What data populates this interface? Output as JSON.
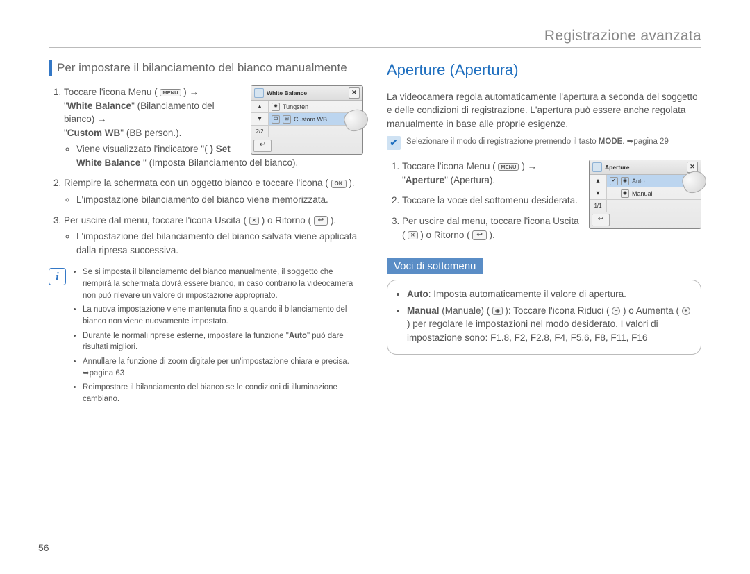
{
  "header": {
    "chapter": "Registrazione avanzata"
  },
  "page_number": "56",
  "left": {
    "title": "Per impostare il bilanciamento del bianco manualmente",
    "step1": {
      "pre": "Toccare l'icona Menu (",
      "menu": "MENU",
      "post": ") →",
      "wb_label": "White Balance",
      "wb_desc": "(Bilanciamento del bianco) →",
      "custom_label": "Custom WB",
      "custom_desc": "(BB person.).",
      "bullet1_pre": "Viene visualizzato l'indicatore \"( ",
      "bullet1_bold": "Set White Balance",
      "bullet1_post": "\" (Imposta Bilanciamento del bianco)."
    },
    "step2": {
      "text": "Riempire la schermata con un oggetto bianco e toccare l'icona ( ",
      "ok": "OK",
      "text_end": " ).",
      "bullet": "L'impostazione bilanciamento del bianco viene memorizzata."
    },
    "step3": {
      "text_a": "Per uscire dal menu, toccare l'icona Uscita ( ",
      "x": "✕",
      "text_b": " ) o Ritorno ( ",
      "ret": "↩",
      "text_c": " ).",
      "bullet": "L'impostazione del bilanciamento del bianco salvata viene applicata dalla ripresa successiva."
    },
    "note": {
      "b1": "Se si imposta il bilanciamento del bianco manualmente, il soggetto che riempirà la schermata dovrà essere bianco, in caso contrario la videocamera non può rilevare un valore di impostazione appropriato.",
      "b2": "La nuova impostazione viene mantenuta fino a quando il bilanciamento del bianco non viene nuovamente impostato.",
      "b3_a": "Durante le normali riprese esterne, impostare la funzione \"",
      "b3_bold": "Auto",
      "b3_b": "\" può dare risultati migliori.",
      "b4": "Annullare la funzione di zoom digitale per un'impostazione chiara e precisa. ➥pagina 63",
      "b5": "Reimpostare il bilanciamento del bianco se le condizioni di illuminazione cambiano."
    },
    "lcd": {
      "title": "White Balance",
      "row1": "Tungsten",
      "row2": "Custom WB",
      "count": "2/2"
    }
  },
  "right": {
    "title": "Aperture (Apertura)",
    "intro": "La videocamera regola automaticamente l'apertura a seconda del soggetto e delle condizioni di registrazione. L'apertura può essere anche regolata manualmente in base alle proprie esigenze.",
    "check": {
      "a": "Selezionare il modo di registrazione premendo il tasto ",
      "bold": "MODE",
      "b": ". ➥pagina 29"
    },
    "step1": {
      "pre": "Toccare l'icona Menu ( ",
      "menu": "MENU",
      "post": " ) →",
      "ap_bold": "Aperture",
      "ap_desc": "(Apertura)."
    },
    "step2": "Toccare la voce del sottomenu desiderata.",
    "step3": {
      "a": "Per uscire dal menu, toccare l'icona Uscita ( ",
      "x": "✕",
      "b": " ) o Ritorno ( ",
      "ret": "↩",
      "c": " )."
    },
    "submenu_title": "Voci di sottomenu",
    "sub": {
      "auto_bold": "Auto",
      "auto_desc": ": Imposta automaticamente il valore di apertura.",
      "manual_bold": "Manual",
      "manual_a": " (Manuale) ( ",
      "manual_b": " ): Toccare l'icona Riduci ( ",
      "manual_c": " ) o Aumenta ( ",
      "manual_d": " ) per regolare le impostazioni nel modo desiderato. I valori di impostazione sono: F1.8, F2, F2.8, F4, F5.6, F8, F11, F16"
    },
    "lcd": {
      "title": "Aperture",
      "row1": "Auto",
      "row2": "Manual",
      "count": "1/1"
    }
  }
}
